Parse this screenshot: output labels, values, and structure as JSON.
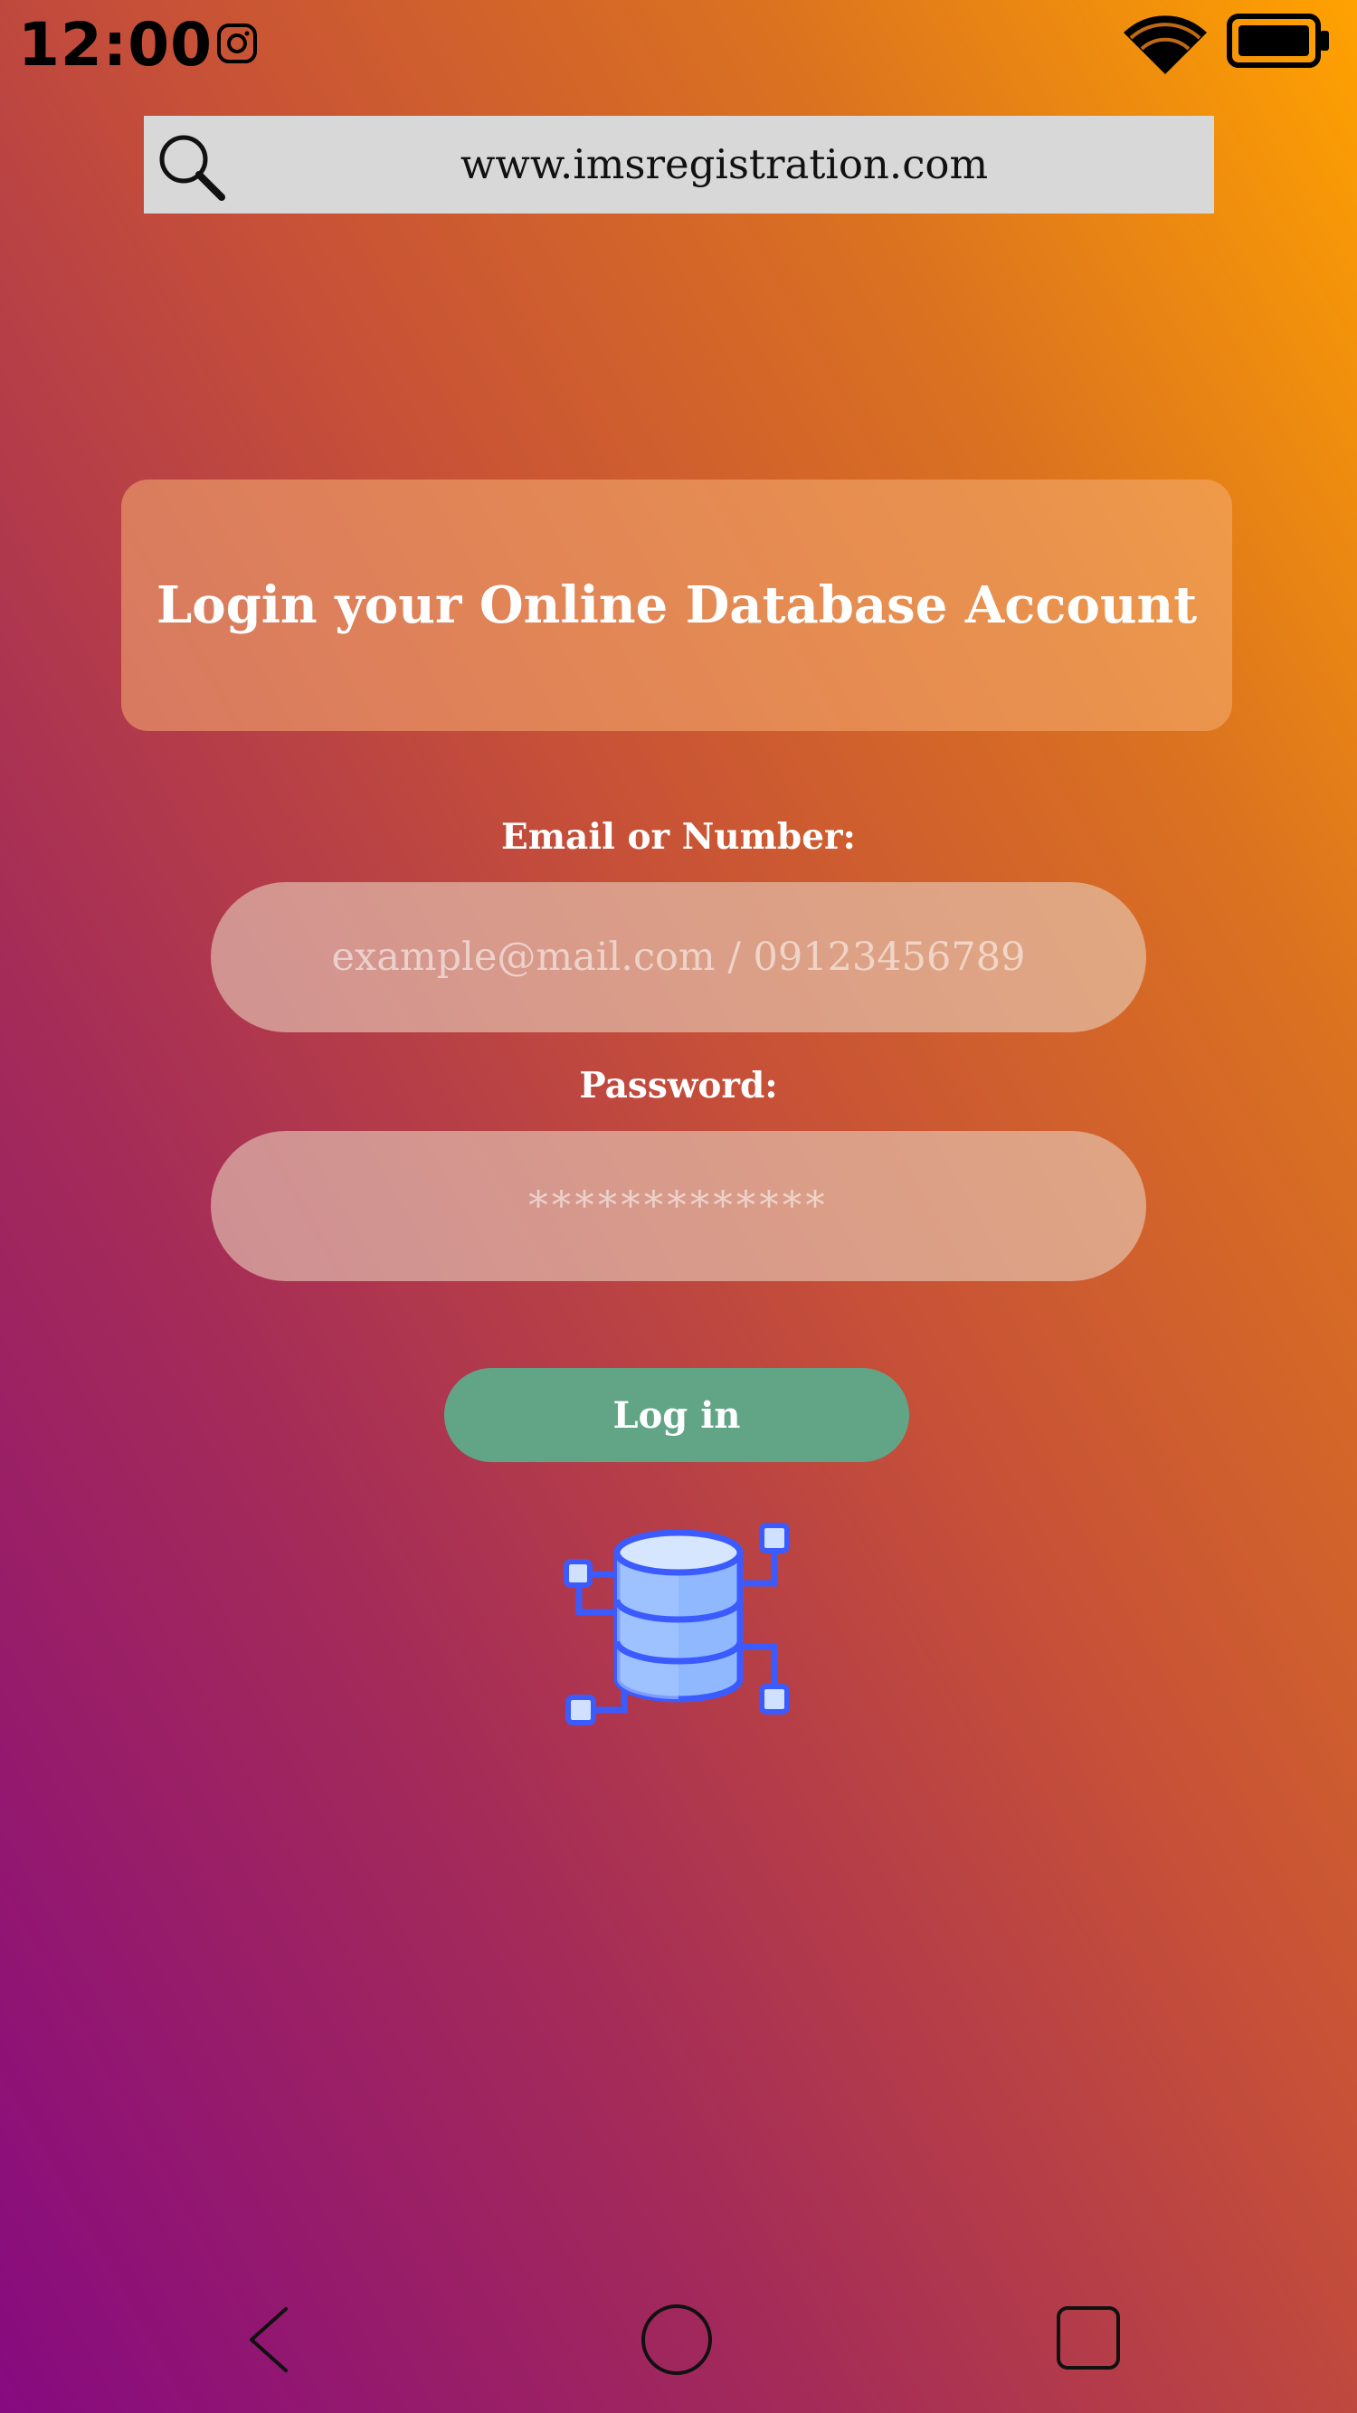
{
  "status_bar": {
    "time": "12:00",
    "icons": [
      "instagram-icon",
      "wifi-icon",
      "battery-icon"
    ]
  },
  "url_bar": {
    "icon": "search-icon",
    "url": "www.imsregistration.com"
  },
  "login_card": {
    "title": "Login your Online Database Account"
  },
  "form": {
    "email_label": "Email or Number:",
    "email_placeholder": "example@mail.com / 09123456789",
    "password_label": "Password:",
    "password_placeholder": "*************",
    "login_label": "Log in"
  },
  "illustration": {
    "icon": "database-network-icon"
  },
  "nav_bar": {
    "items": [
      "back-icon",
      "home-icon",
      "recents-icon"
    ]
  },
  "colors": {
    "gradient_start": "#870a80",
    "gradient_end": "#ffa200",
    "button": "#62a586",
    "url_bar": "#d8d8d8"
  }
}
